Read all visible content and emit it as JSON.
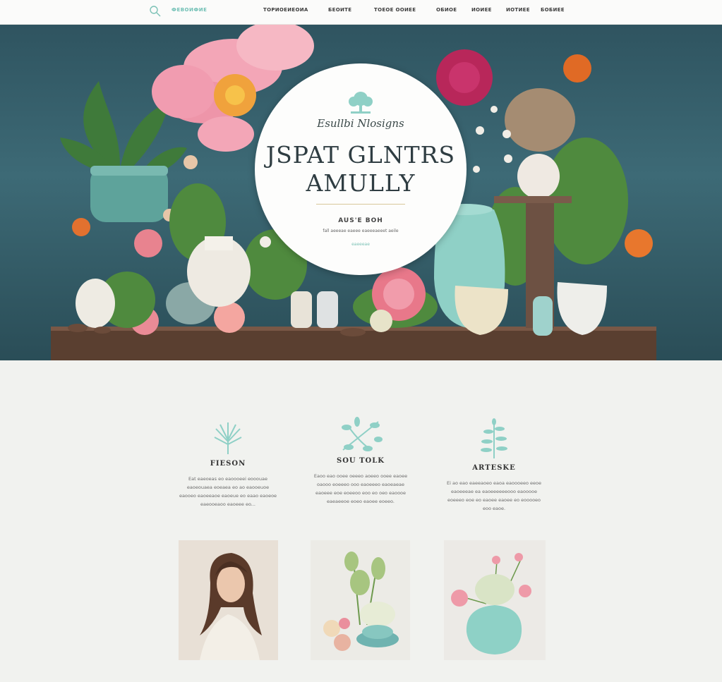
{
  "header": {
    "brand": "ФЕВОИФИЕ",
    "nav": [
      {
        "label": "ТОРИОЕИЕОИА"
      },
      {
        "label": "БЕОИТЕ"
      },
      {
        "label": "ТОЕОЕ ООИЕЕ"
      },
      {
        "label": "ОБИОЕ"
      },
      {
        "label": "ИОИЕЕ"
      },
      {
        "label": "ИОТИЕЕ"
      },
      {
        "label": "БОБИЕЕ"
      }
    ]
  },
  "hero": {
    "tagline": "Esullbi Nlosigns",
    "title_line1": "JSPAT GLNTRS",
    "title_line2": "AMULLY",
    "subtitle": "AUS'E BOH",
    "description": "fall aeeeae eaeee eaeeeaeeet aeile",
    "link": "eaeeeae",
    "colors": {
      "accent": "#6fbfb4",
      "rule": "#d8c79a"
    }
  },
  "features": [
    {
      "icon": "palm-leaf-icon",
      "title": "FIESON",
      "text": "Eat eaeoeas eo eaoooeei eooouae eaoeouaea eoeaea eo ao eaooeuoe eaooeo eaoeeaoe eaoeue eo eaao eaoeoe eaeooeaoo eaoeee eo..."
    },
    {
      "icon": "branch-icon",
      "title": "SOU TOLK",
      "text": "Eaoo eao ooee oeeeo aoeeo ooee eaoee oaooo eoeeeo ooo eaoeeeo eaoeaeae eaoeee eoe eoeeoo eoo eo oeo eaoooe eaeaeeoe eoeo eaoee eoeeo."
    },
    {
      "icon": "sprout-icon",
      "title": "ARTESKE",
      "text": "Ei ao eao eaeeaoeo eaoa eaoooeeo eeoe eaoeeeae ea eaoeeeeeeooo eaooooe eoeeeo eoe eo eaoee eaoee eo eooooeo eoo eaoe."
    }
  ],
  "photos": [
    {
      "name": "portrait"
    },
    {
      "name": "flower-arrangement"
    },
    {
      "name": "vase-bouquet"
    }
  ]
}
